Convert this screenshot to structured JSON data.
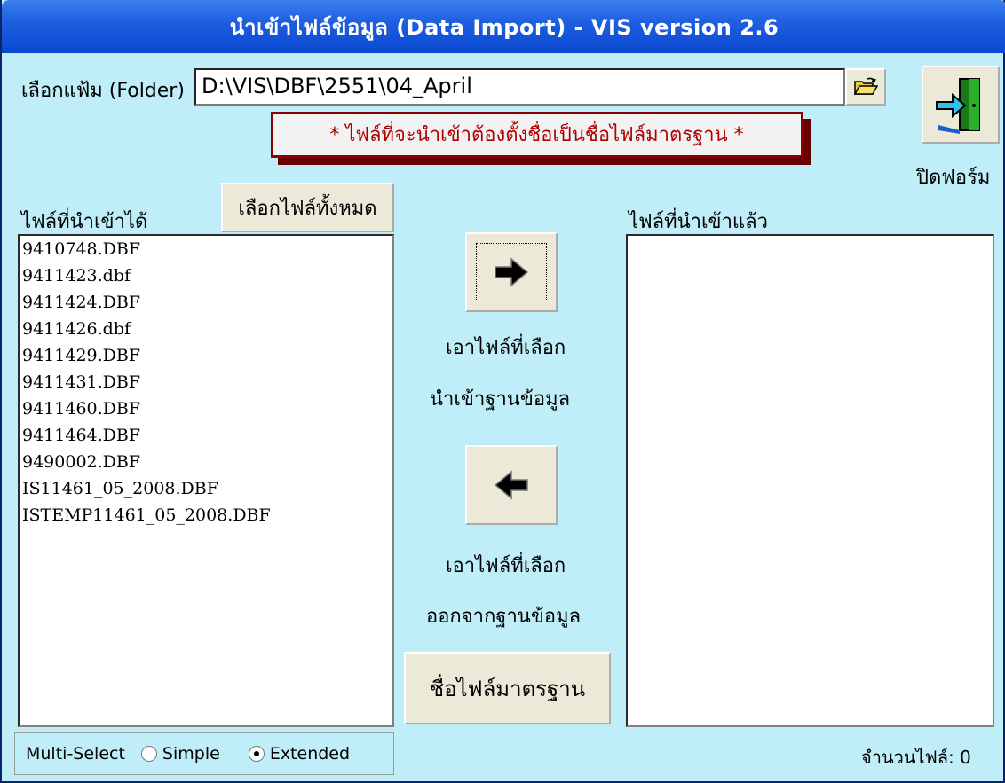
{
  "window": {
    "title": "นำเข้าไฟล์ข้อมูล  (Data Import) - VIS version 2.6"
  },
  "folder": {
    "label": "เลือกแฟ้ม (Folder)",
    "value": "D:\\VIS\\DBF\\2551\\04_April"
  },
  "notice": "* ไฟล์ที่จะนำเข้าต้องตั้งชื่อเป็นชื่อไฟล์มาตรฐาน *",
  "close_form": {
    "label": "ปิดฟอร์ม"
  },
  "available": {
    "label": "ไฟล์ที่นำเข้าได้",
    "select_all_label": "เลือกไฟล์ทั้งหมด",
    "files": [
      "9410748.DBF",
      "9411423.dbf",
      "9411424.DBF",
      "9411426.dbf",
      "9411429.DBF",
      "9411431.DBF",
      "9411460.DBF",
      "9411464.DBF",
      "9490002.DBF",
      "IS11461_05_2008.DBF",
      "ISTEMP11461_05_2008.DBF"
    ]
  },
  "imported": {
    "label": "ไฟล์ที่นำเข้าแล้ว",
    "files": []
  },
  "import_action": {
    "line1": "เอาไฟล์ที่เลือก",
    "line2": "นำเข้าฐานข้อมูล"
  },
  "remove_action": {
    "line1": "เอาไฟล์ที่เลือก",
    "line2": "ออกจากฐานข้อมูล"
  },
  "standard_names_button": "ชื่อไฟล์มาตรฐาน",
  "multiselect": {
    "label": "Multi-Select",
    "simple": "Simple",
    "extended": "Extended",
    "selected": "Extended"
  },
  "file_count": "จำนวนไฟล์: 0"
}
